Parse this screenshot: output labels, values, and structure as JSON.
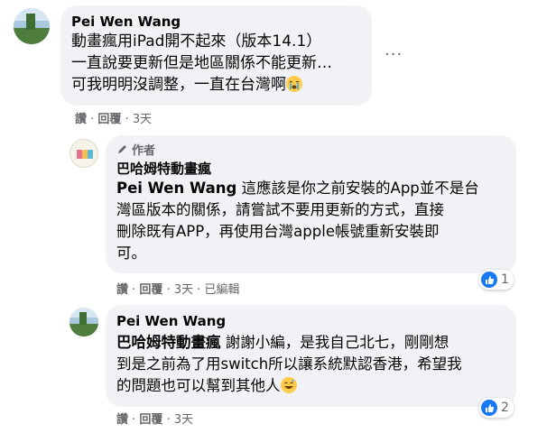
{
  "comments": [
    {
      "author": "Pei Wen Wang",
      "lines": [
        "動畫瘋用iPad開不起來（版本14.1）",
        "一直說要更新但是地區關係不能更新…",
        "可我明明沒調整，一直在台灣啊"
      ],
      "like_label": "讚",
      "reply_label": "回覆",
      "time": "3天",
      "more_label": "···"
    }
  ],
  "replies": [
    {
      "author_badge": "作者",
      "author": "巴哈姆特動畫瘋",
      "mention": "Pei Wen Wang",
      "lines": [
        "這應該是你之前安裝的App並不是台",
        "灣區版本的關係，請嘗試不要用更新的方式，直接",
        "刪除既有APP，再使用台灣apple帳號重新安裝即",
        "可。"
      ],
      "like_label": "讚",
      "reply_label": "回覆",
      "time": "3天",
      "edited": "已編輯",
      "reaction_count": "1"
    },
    {
      "author": "Pei Wen Wang",
      "mention": "巴哈姆特動畫瘋",
      "lines": [
        "謝謝小編，是我自己北七，剛剛想",
        "到是之前為了用switch所以讓系統默認香港，希望我",
        "的問題也可以幫到其他人"
      ],
      "like_label": "讚",
      "reply_label": "回覆",
      "time": "3天",
      "reaction_count": "2"
    }
  ],
  "colors": {
    "bubble": "#f0f2f5",
    "secondary_text": "#65676b",
    "like_blue": "#1877f2"
  }
}
